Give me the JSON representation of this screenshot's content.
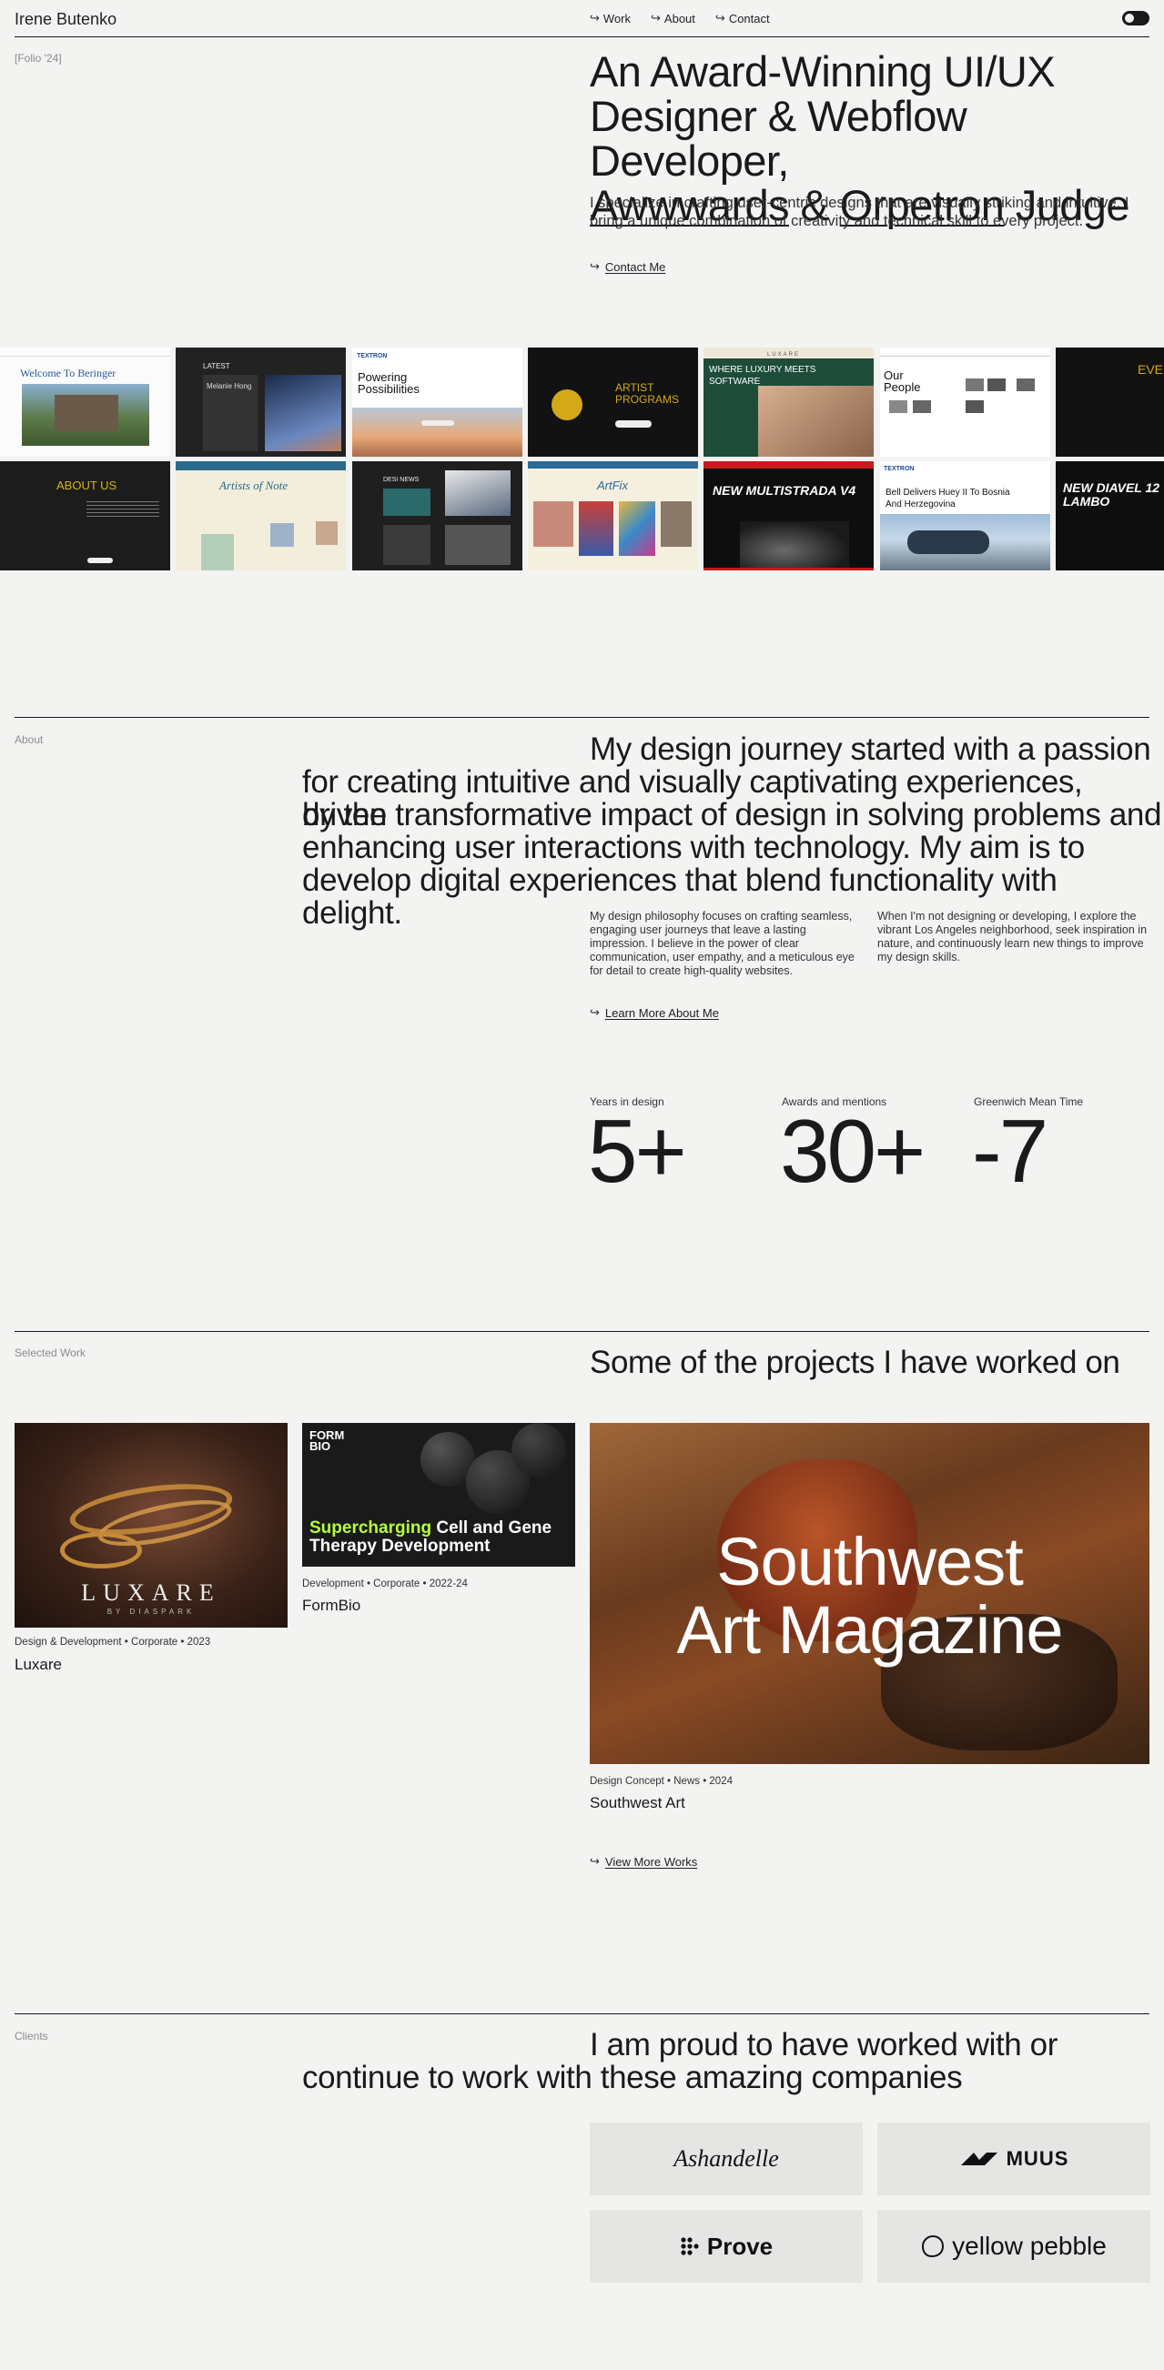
{
  "nav": {
    "brand": "Irene Butenko",
    "links": [
      {
        "label": "Work"
      },
      {
        "label": "About"
      },
      {
        "label": "Contact"
      }
    ]
  },
  "hero": {
    "folio": "[Folio '24]",
    "title_line1": "An Award-Winning UI/UX",
    "title_line2": "Designer & Webflow Developer,",
    "title_awwwards": "Awwwards",
    "title_amp": "&",
    "title_orpetron": "Orpetron",
    "title_judge": "Judge",
    "subtitle": "I specialize in crafting user-centric designs that are visually striking and intuitive. I bring a unique combination of creativity and technical skill to every project.",
    "cta": "Contact Me"
  },
  "thumbnails": {
    "row1": [
      "Welcome To Beringer",
      "LATEST",
      "Powering Possibilities",
      "ARTIST PROGRAMS",
      "WHERE LUXURY MEETS SOFTWARE",
      "Our People",
      "EVEN"
    ],
    "row2": [
      "ABOUT US",
      "Artists of Note",
      "DESI NEWS",
      "ArtFix",
      "NEW MULTISTRADA V4",
      "Bell Delivers Huey II To Bosnia And Herzegovina",
      "NEW DIAVEL 12 LAMBO"
    ],
    "sub_labels": [
      "TEXTRON",
      "Melanie Hong",
      "LUXARE"
    ]
  },
  "about": {
    "label": "About",
    "line1": "My design journey started with a passion",
    "line2": "for creating intuitive and visually captivating experiences, driven",
    "line3": "by the transformative impact of design in solving problems and",
    "line4": "enhancing user interactions with technology. My aim is to",
    "line5": "develop digital experiences that blend functionality with delight.",
    "para1": "My design philosophy focuses on crafting seamless, engaging user journeys that leave a lasting impression. I believe in the power of clear communication, user empathy, and a meticulous eye for detail to create high-quality websites.",
    "para2": "When I'm not designing or developing, I explore the vibrant Los Angeles neighborhood, seek inspiration in nature, and continuously learn new things to improve my design skills.",
    "cta": "Learn More About Me",
    "stats": [
      {
        "label": "Years in design",
        "value": "5+"
      },
      {
        "label": "Awards and mentions",
        "value": "30+"
      },
      {
        "label": "Greenwich Mean Time",
        "value": "-7"
      }
    ]
  },
  "work": {
    "label": "Selected Work",
    "heading": "Some of the projects I have worked on",
    "projects": [
      {
        "title": "Luxare",
        "meta": "Design & Development • Corporate • 2023",
        "logo": "LUXARE",
        "logo_sub": "BY DIASPARK"
      },
      {
        "title": "FormBio",
        "meta": "Development • Corporate • 2022-24",
        "logo": "FORM BIO",
        "headline_hl": "Supercharging",
        "headline_rest": " Cell and Gene Therapy Development"
      },
      {
        "title": "Southwest Art",
        "meta": "Design Concept • News • 2024",
        "line1": "Southwest",
        "line2": "Art Magazine"
      }
    ],
    "cta": "View More Works"
  },
  "clients": {
    "label": "Clients",
    "line1": "I am proud to have worked with or",
    "line2": "continue to work with these amazing companies",
    "logos": [
      "Ashandelle",
      "MUUS",
      "Prove",
      "yellow pebble"
    ]
  },
  "colors": {
    "background": "#f3f3f2",
    "text": "#1a1a1a",
    "muted": "#8c8c8c",
    "client_tile": "#e5e5e4",
    "formbio_accent": "#b6ff3b"
  }
}
